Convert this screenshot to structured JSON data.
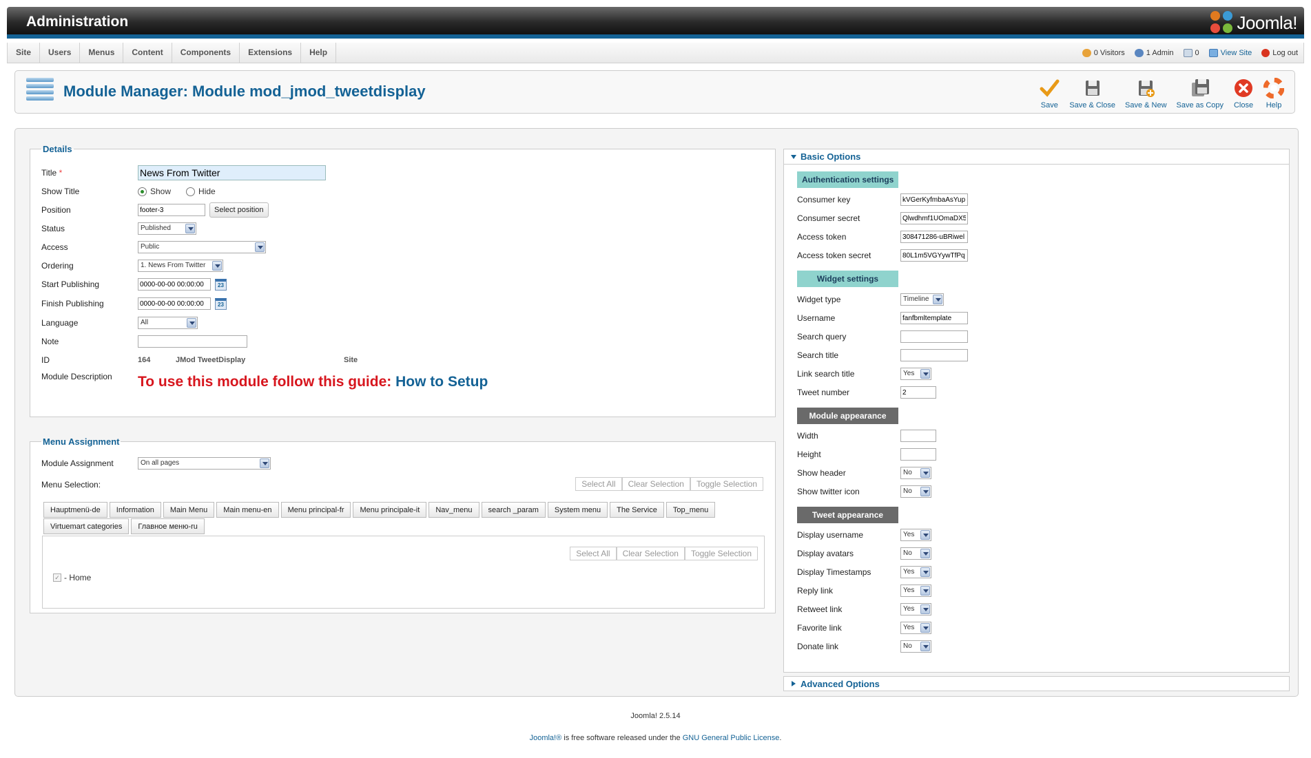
{
  "header": {
    "title": "Administration",
    "logo_text": "Joomla!"
  },
  "menu": [
    "Site",
    "Users",
    "Menus",
    "Content",
    "Components",
    "Extensions",
    "Help"
  ],
  "status": {
    "visitors": "0 Visitors",
    "admins": "1 Admin",
    "messages": "0",
    "view_site": "View Site",
    "logout": "Log out"
  },
  "toolbar": {
    "page_title": "Module Manager: Module mod_jmod_tweetdisplay",
    "buttons": [
      "Save",
      "Save & Close",
      "Save & New",
      "Save as Copy",
      "Close",
      "Help"
    ]
  },
  "details": {
    "legend": "Details",
    "title_label": "Title",
    "title_required": "*",
    "title_value": "News From Twitter",
    "show_title_label": "Show Title",
    "show_label": "Show",
    "hide_label": "Hide",
    "position_label": "Position",
    "position_value": "footer-3",
    "select_position": "Select position",
    "status_label": "Status",
    "status_value": "Published",
    "access_label": "Access",
    "access_value": "Public",
    "ordering_label": "Ordering",
    "ordering_value": "1. News From Twitter",
    "start_label": "Start Publishing",
    "start_value": "0000-00-00 00:00:00",
    "finish_label": "Finish Publishing",
    "finish_value": "0000-00-00 00:00:00",
    "calendar_day": "23",
    "language_label": "Language",
    "language_value": "All",
    "note_label": "Note",
    "note_value": "",
    "id_label": "ID",
    "id_value": "164",
    "module_name": "JMod TweetDisplay",
    "client": "Site",
    "desc_label": "Module Description",
    "desc_text": "To use this module follow this guide:",
    "desc_link": "How to Setup"
  },
  "menu_assignment": {
    "legend": "Menu Assignment",
    "assignment_label": "Module Assignment",
    "assignment_value": "On all pages",
    "selection_label": "Menu Selection:",
    "select_all": "Select All",
    "clear_selection": "Clear Selection",
    "toggle_selection": "Toggle Selection",
    "tabs": [
      "Hauptmenü-de",
      "Information",
      "Main Menu",
      "Main menu-en",
      "Menu principal-fr",
      "Menu principale-it",
      "Nav_menu",
      "search _param",
      "System menu",
      "The Service",
      "Top_menu",
      "Virtuemart categories",
      "Главное меню-ru"
    ],
    "item_home": "- Home"
  },
  "basic_options": {
    "header": "Basic Options",
    "auth_section": "Authentication settings",
    "consumer_key_label": "Consumer key",
    "consumer_key": "kVGerKyfmbaAsYup",
    "consumer_secret_label": "Consumer secret",
    "consumer_secret": "Qlwdhmf1UOmaDX5",
    "access_token_label": "Access token",
    "access_token": "308471286-uBRiwel",
    "access_token_secret_label": "Access token secret",
    "access_token_secret": "80L1m5VGYywTfPq",
    "widget_section": "Widget settings",
    "widget_type_label": "Widget type",
    "widget_type": "Timeline",
    "username_label": "Username",
    "username": "fanfbmltemplate",
    "search_query_label": "Search query",
    "search_query": "",
    "search_title_label": "Search title",
    "search_title": "",
    "link_search_title_label": "Link search title",
    "link_search_title": "Yes",
    "tweet_number_label": "Tweet number",
    "tweet_number": "2",
    "appearance_section": "Module appearance",
    "width_label": "Width",
    "width": "",
    "height_label": "Height",
    "height": "",
    "show_header_label": "Show header",
    "show_header": "No",
    "show_twitter_icon_label": "Show twitter icon",
    "show_twitter_icon": "No",
    "tweet_section": "Tweet appearance",
    "display_username_label": "Display username",
    "display_username": "Yes",
    "display_avatars_label": "Display avatars",
    "display_avatars": "No",
    "display_timestamps_label": "Display Timestamps",
    "display_timestamps": "Yes",
    "reply_link_label": "Reply link",
    "reply_link": "Yes",
    "retweet_link_label": "Retweet link",
    "retweet_link": "Yes",
    "favorite_link_label": "Favorite link",
    "favorite_link": "Yes",
    "donate_link_label": "Donate link",
    "donate_link": "No"
  },
  "advanced_options": {
    "header": "Advanced Options"
  },
  "footer": {
    "version": "Joomla! 2.5.14",
    "joomla_link": "Joomla!®",
    "license_text": " is free software released under the ",
    "license_link": "GNU General Public License",
    "period": "."
  },
  "colors": {
    "accent": "#146295",
    "header_bar": "#146295",
    "teal_section": "#8fd3cd",
    "dark_section": "#6a6a6a",
    "desc_red": "#d7161e"
  }
}
